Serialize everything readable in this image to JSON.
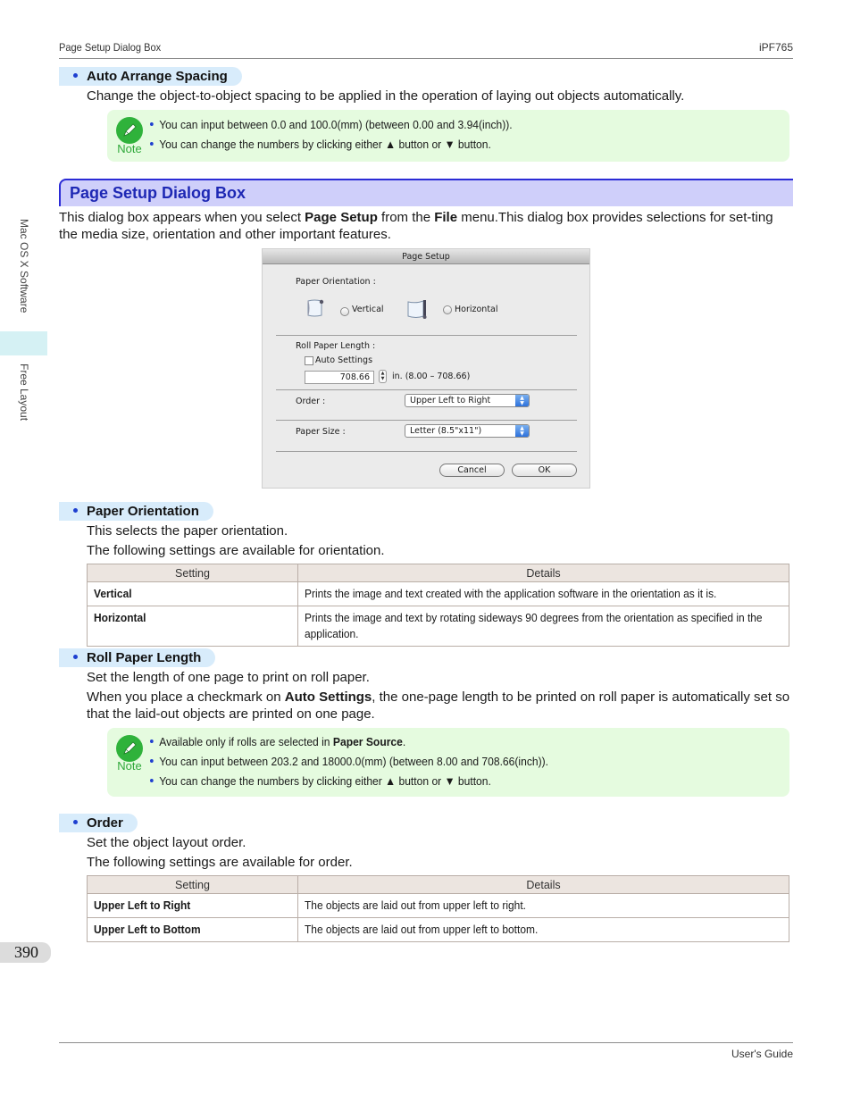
{
  "header": {
    "left": "Page Setup Dialog Box",
    "right": "iPF765"
  },
  "footer": {
    "right": "User's Guide"
  },
  "side_tabs": {
    "mac": "Mac OS X Software",
    "free": "Free Layout"
  },
  "page_number": "390",
  "auto_arrange": {
    "heading": "Auto Arrange Spacing",
    "text": "Change the object-to-object spacing to be applied in the operation of laying out objects automatically.",
    "note_label": "Note",
    "notes": [
      "You can input between 0.0 and 100.0(mm) (between 0.00 and 3.94(inch)).",
      "You can change the numbers by clicking either ▲ button or ▼ button."
    ]
  },
  "section": {
    "title": "Page Setup Dialog Box",
    "intro_1": "This dialog box appears when you select ",
    "intro_b1": "Page Setup",
    "intro_2": " from the ",
    "intro_b2": "File",
    "intro_3": " menu.This dialog box provides selections for set-ting the media size, orientation and other important features."
  },
  "dialog": {
    "title": "Page Setup",
    "orientation_label": "Paper Orientation :",
    "vertical_label": "Vertical",
    "horizontal_label": "Horizontal",
    "roll_label": "Roll Paper Length :",
    "auto_settings_label": "Auto Settings",
    "length_value": "708.66",
    "length_range": "in. (8.00 – 708.66)",
    "order_label": "Order :",
    "order_value": "Upper Left to Right",
    "paper_size_label": "Paper Size :",
    "paper_size_value": "Letter (8.5\"x11\")",
    "cancel_label": "Cancel",
    "ok_label": "OK"
  },
  "paper_orientation": {
    "heading": "Paper Orientation",
    "text_1": "This selects the paper orientation.",
    "text_2": "The following settings are available for orientation.",
    "table": {
      "headers": [
        "Setting",
        "Details"
      ],
      "rows": [
        {
          "setting": "Vertical",
          "details": "Prints the image and text created with the application software in the orientation as it is."
        },
        {
          "setting": "Horizontal",
          "details": "Prints the image and text by rotating sideways 90 degrees from the orientation as specified in the application."
        }
      ]
    }
  },
  "roll_paper_length": {
    "heading": "Roll Paper Length",
    "text_1": "Set the length of one page to print on roll paper.",
    "text_2a": "When you place a checkmark on ",
    "text_2b": "Auto Settings",
    "text_2c": ", the one-page length to be printed on roll paper is automatically set so that the laid-out objects are printed on one page.",
    "note_label": "Note",
    "note_1a": "Available only if rolls are selected in ",
    "note_1b": "Paper Source",
    "note_1c": ".",
    "note_2": "You can input between 203.2 and 18000.0(mm) (between 8.00 and 708.66(inch)).",
    "note_3": "You can change the numbers by clicking either ▲ button or ▼ button."
  },
  "order": {
    "heading": "Order",
    "text_1": "Set the object layout order.",
    "text_2": "The following settings are available for order.",
    "table": {
      "headers": [
        "Setting",
        "Details"
      ],
      "rows": [
        {
          "setting": "Upper Left to Right",
          "details": "The objects are laid out from upper left to right."
        },
        {
          "setting": "Upper Left to Bottom",
          "details": "The objects are laid out from upper left to bottom."
        }
      ]
    }
  },
  "colors": {
    "section_bg": "#cfcffa",
    "section_text": "#1e28b4",
    "pill_bg": "#d8ecfb",
    "note_bg": "#e5fbdf",
    "note_green": "#2fb23b",
    "table_header_bg": "#ece5e0"
  }
}
